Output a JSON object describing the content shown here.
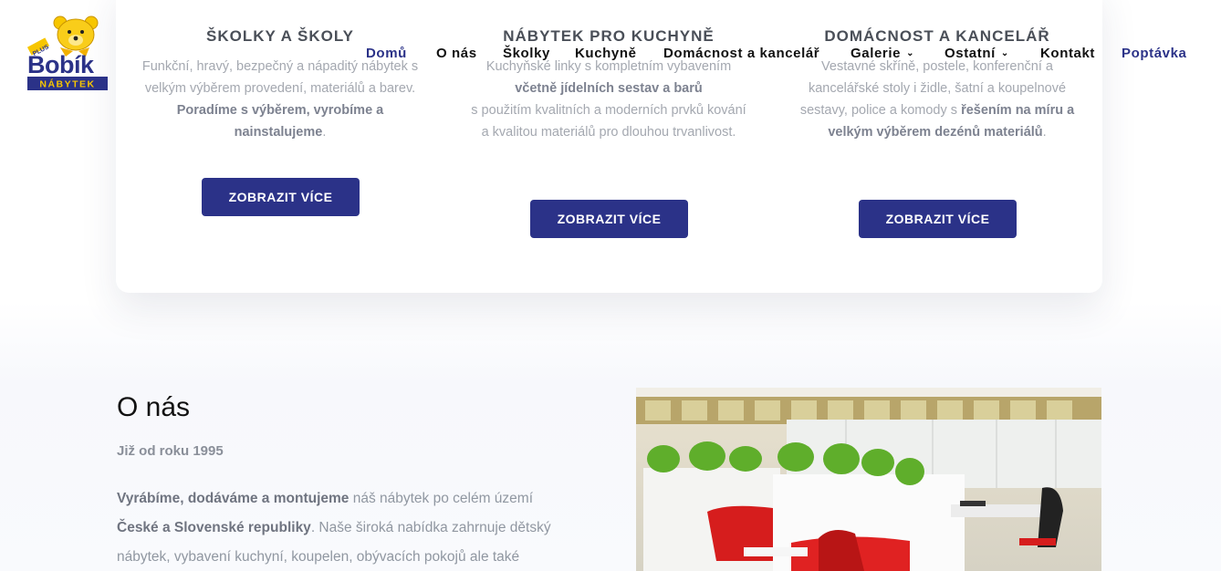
{
  "logo": {
    "plus": "PLUS",
    "name": "Bobík",
    "sub": "NÁBYTEK"
  },
  "nav": [
    {
      "label": "Domů",
      "active": true
    },
    {
      "label": "O nás"
    },
    {
      "label": "Školky"
    },
    {
      "label": "Kuchyně"
    },
    {
      "label": "Domácnost a kancelář"
    },
    {
      "label": "Galerie",
      "dropdown": true
    },
    {
      "label": "Ostatní",
      "dropdown": true
    },
    {
      "label": "Kontakt"
    },
    {
      "label": "Poptávka",
      "cta": true
    }
  ],
  "cards": [
    {
      "title": "ŠKOLKY A ŠKOLY",
      "line1": "Funkční, hravý, bezpečný a nápaditý nábytek s velkým výběrem provedení, materiálů a barev.",
      "bold": "Poradíme s výběrem, vyrobíme a nainstalujeme",
      "tail": ".",
      "button": "ZOBRAZIT VÍCE"
    },
    {
      "title": "NÁBYTEK PRO KUCHYNĚ",
      "line1": "Kuchyňské linky s kompletním vybavením",
      "bold": "včetně jídelních sestav a barů",
      "tail": "s použitím kvalitních a moderních prvků kování a kvalitou materiálů pro dlouhou trvanlivost.",
      "button": "ZOBRAZIT VÍCE"
    },
    {
      "title": "DOMÁCNOST A KANCELÁŘ",
      "line1": "Vestavné skříně, postele, konferenční a kancelářské stoly i židle, šatní a koupelnové sestavy, police a komody s",
      "bold": "řešením na míru a velkým výběrem dezénů materiálů",
      "tail": ".",
      "button": "ZOBRAZIT VÍCE"
    }
  ],
  "about": {
    "title": "O nás",
    "subtitle": "Již od roku 1995",
    "bold1": "Vyrábíme, dodáváme a montujeme",
    "text1": " náš nábytek po celém území ",
    "bold2": "České a Slovenské republiky",
    "text2": ". Naše široká nabídka zahrnuje dětský nábytek, vybavení kuchyní, koupelen, obývacích pokojů ale také"
  },
  "colors": {
    "brand": "#2b3288",
    "logo_yellow": "#f7c600"
  }
}
